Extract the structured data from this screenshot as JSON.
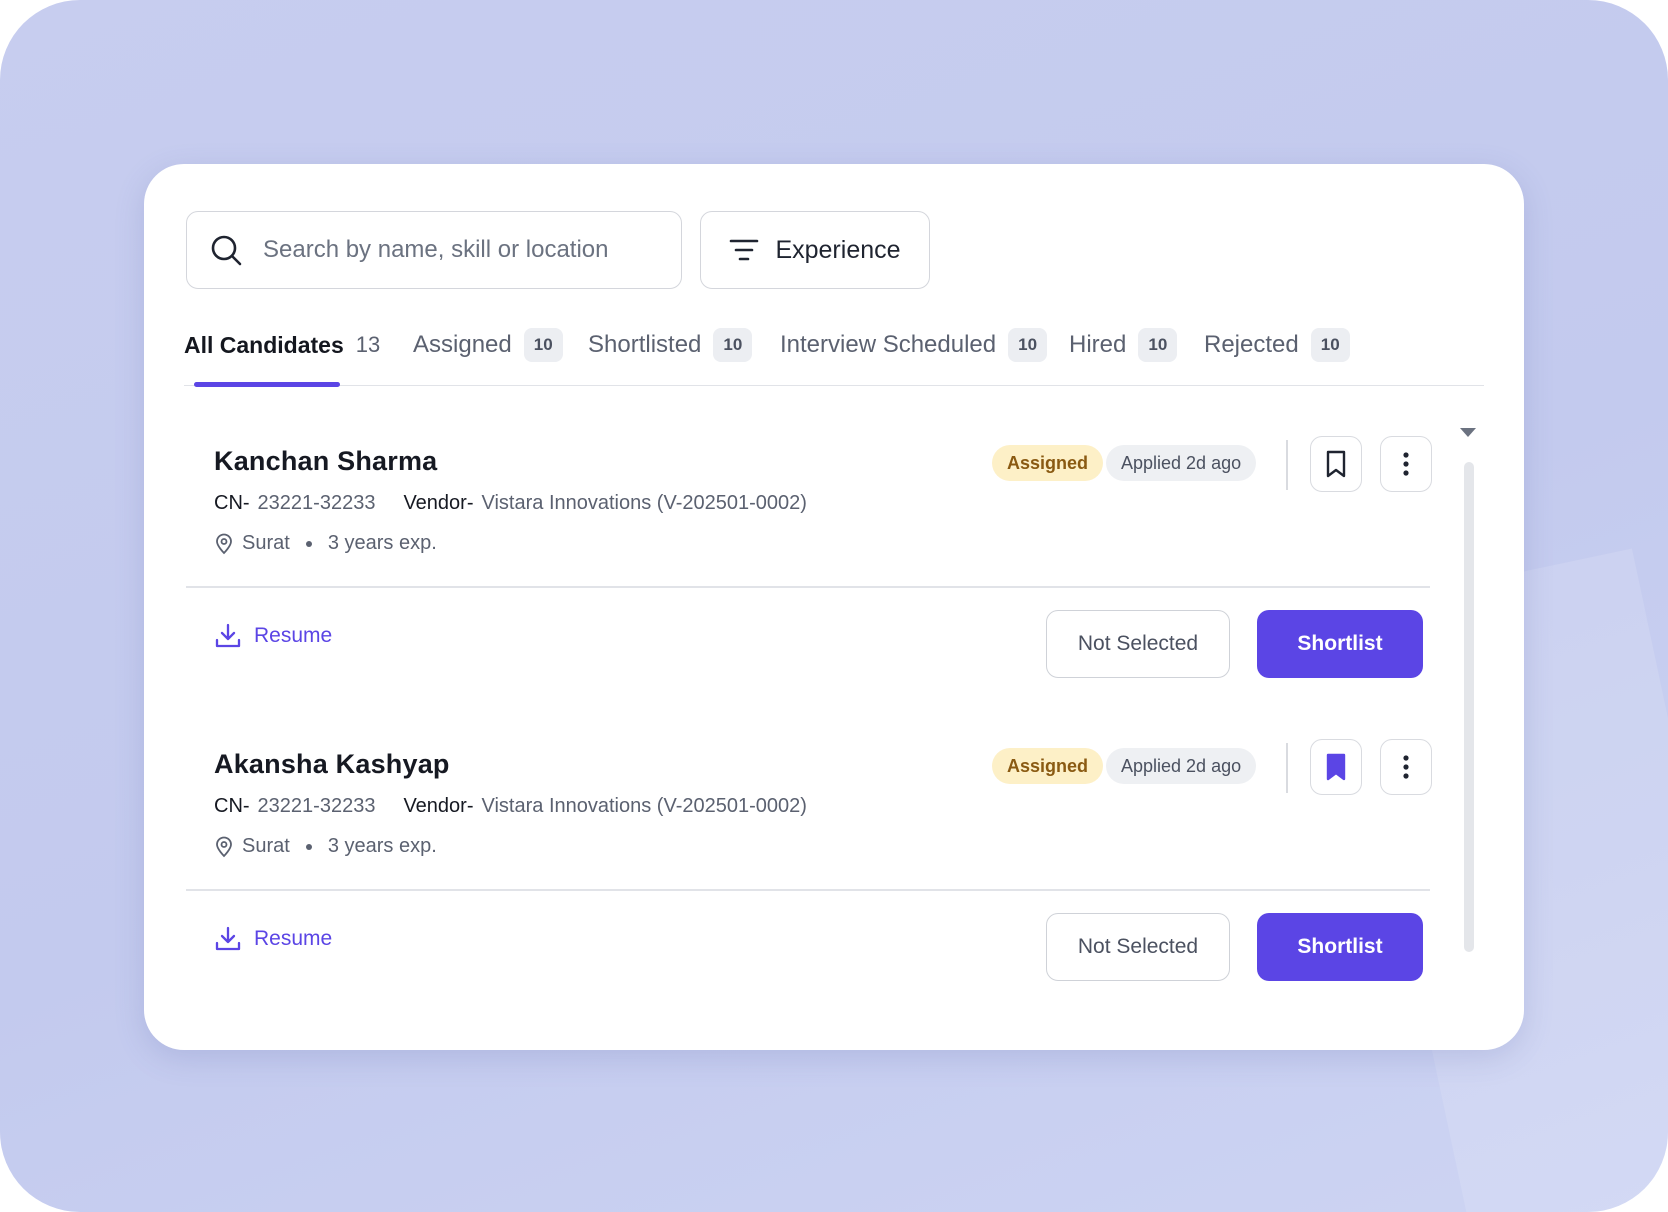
{
  "search": {
    "placeholder": "Search by name, skill or location"
  },
  "filter": {
    "label": "Experience"
  },
  "tabs": [
    {
      "label": "All Candidates",
      "count": "13",
      "active": true
    },
    {
      "label": "Assigned",
      "count": "10"
    },
    {
      "label": "Shortlisted",
      "count": "10"
    },
    {
      "label": "Interview Scheduled",
      "count": "10"
    },
    {
      "label": "Hired",
      "count": "10"
    },
    {
      "label": "Rejected",
      "count": "10"
    }
  ],
  "candidates": [
    {
      "name": "Kanchan Sharma",
      "cn_label": "CN-",
      "cn": "23221-32233",
      "vendor_label": "Vendor-",
      "vendor": "Vistara Innovations (V-202501-0002)",
      "location": "Surat",
      "experience": "3 years exp.",
      "status_badge": "Assigned",
      "applied": "Applied 2d ago",
      "bookmarked": false,
      "resume_label": "Resume",
      "not_selected_label": "Not Selected",
      "shortlist_label": "Shortlist"
    },
    {
      "name": "Akansha Kashyap",
      "cn_label": "CN-",
      "cn": "23221-32233",
      "vendor_label": "Vendor-",
      "vendor": "Vistara Innovations (V-202501-0002)",
      "location": "Surat",
      "experience": "3 years exp.",
      "status_badge": "Assigned",
      "applied": "Applied 2d ago",
      "bookmarked": true,
      "resume_label": "Resume",
      "not_selected_label": "Not Selected",
      "shortlist_label": "Shortlist"
    }
  ],
  "colors": {
    "accent": "#5b45e5",
    "assigned_bg": "#fdf0c7",
    "assigned_text": "#8a5a12",
    "backdrop": "#c7cdef"
  },
  "icons": {
    "search": "search-icon",
    "filter": "filter-lines-icon",
    "bookmark": "bookmark-icon",
    "more": "more-vertical-icon",
    "location": "location-pin-icon",
    "download": "download-icon"
  }
}
